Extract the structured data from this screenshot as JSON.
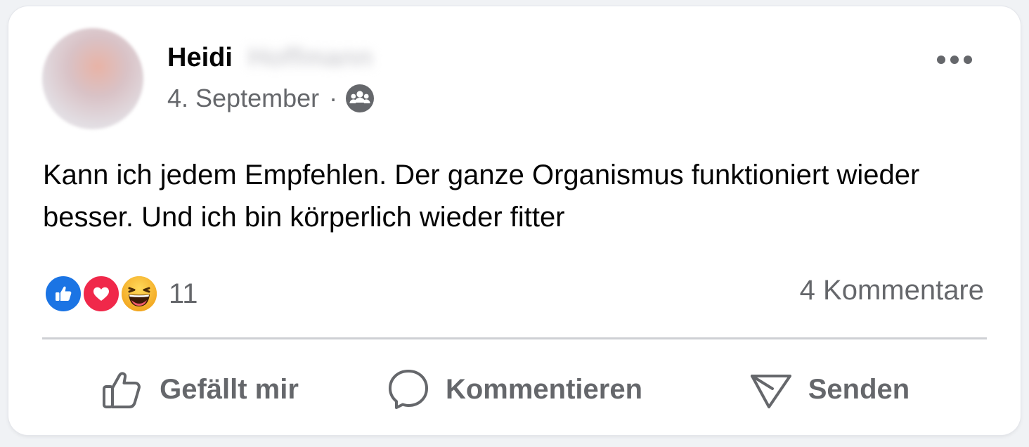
{
  "post": {
    "author_first_name": "Heidi",
    "author_surname_redacted": "Hoffmann",
    "date": "4. September",
    "separator": "·",
    "audience_icon": "friends-icon",
    "more_icon": "more-options-icon",
    "text": "Kann ich jedem Empfehlen. Der ganze Organismus funktioniert wieder besser. Und ich bin körperlich wieder fitter"
  },
  "stats": {
    "reaction_icons": [
      "like-icon",
      "love-icon",
      "haha-icon"
    ],
    "reaction_count": "11",
    "comment_count": "4 Kommentare"
  },
  "actions": {
    "like_label": "Gefällt mir",
    "comment_label": "Kommentieren",
    "send_label": "Senden"
  },
  "colors": {
    "like_blue": "#1b74e4",
    "love_red": "#f0284a",
    "haha_yellow": "#f7b928",
    "secondary_text": "#65676b"
  }
}
